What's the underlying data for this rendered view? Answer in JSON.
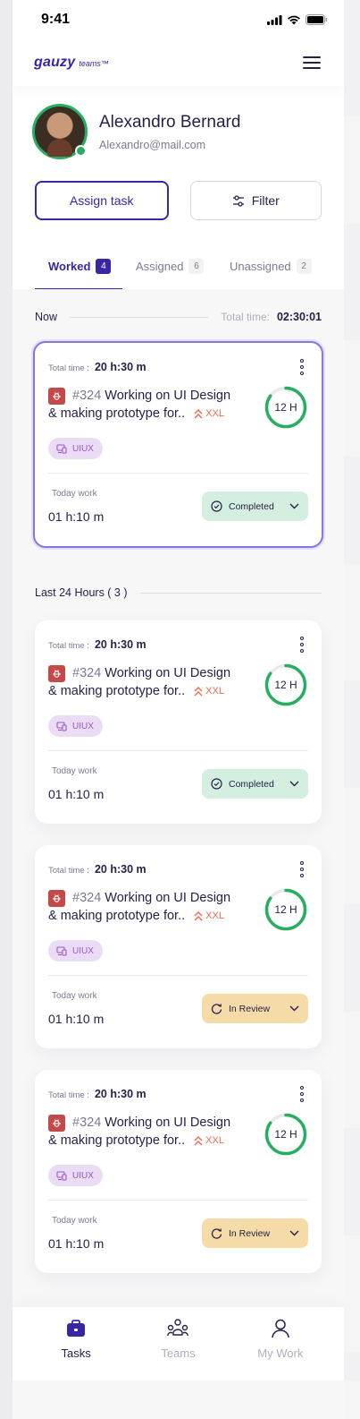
{
  "status_bar": {
    "time": "9:41"
  },
  "header": {
    "logo_main": "gauzy",
    "logo_sub": "teams™"
  },
  "profile": {
    "name": "Alexandro Bernard",
    "email": "Alexandro@mail.com"
  },
  "actions": {
    "assign_label": "Assign task",
    "filter_label": "Filter"
  },
  "tabs": [
    {
      "label": "Worked",
      "count": "4",
      "active": true
    },
    {
      "label": "Assigned",
      "count": "6",
      "active": false
    },
    {
      "label": "Unassigned",
      "count": "2",
      "active": false
    }
  ],
  "now_section": {
    "label": "Now",
    "total_label": "Total time:",
    "total_value": "02:30:01"
  },
  "last24_section": {
    "label": "Last 24 Hours ( 3 )"
  },
  "tasks": [
    {
      "total_label": "Total time :",
      "total_value": "20 h:30 m",
      "task_number": "#324",
      "title_line1": "Working on UI Design",
      "title_line2": "& making prototype for..",
      "size": "XXL",
      "estimate": "12 H",
      "progress_fraction": 0.85,
      "tag": "UIUX",
      "today_label": "Today work",
      "today_value": "01 h:10 m",
      "status": "Completed",
      "status_type": "completed",
      "selected": true
    },
    {
      "total_label": "Total time :",
      "total_value": "20 h:30 m",
      "task_number": "#324",
      "title_line1": "Working on UI Design",
      "title_line2": "& making prototype for..",
      "size": "XXL",
      "estimate": "12 H",
      "progress_fraction": 0.85,
      "tag": "UIUX",
      "today_label": "Today work",
      "today_value": "01 h:10 m",
      "status": "Completed",
      "status_type": "completed",
      "selected": false
    },
    {
      "total_label": "Total time :",
      "total_value": "20 h:30 m",
      "task_number": "#324",
      "title_line1": "Working on UI Design",
      "title_line2": "& making prototype for..",
      "size": "XXL",
      "estimate": "12 H",
      "progress_fraction": 0.85,
      "tag": "UIUX",
      "today_label": "Today work",
      "today_value": "01 h:10 m",
      "status": "In Review",
      "status_type": "review",
      "selected": false
    },
    {
      "total_label": "Total time :",
      "total_value": "20 h:30 m",
      "task_number": "#324",
      "title_line1": "Working on UI Design",
      "title_line2": "& making prototype for..",
      "size": "XXL",
      "estimate": "12 H",
      "progress_fraction": 0.85,
      "tag": "UIUX",
      "today_label": "Today work",
      "today_value": "01 h:10 m",
      "status": "In Review",
      "status_type": "review",
      "selected": false
    }
  ],
  "bottom_nav": [
    {
      "label": "Tasks",
      "icon": "briefcase-icon",
      "active": true
    },
    {
      "label": "Teams",
      "icon": "people-icon",
      "active": false
    },
    {
      "label": "My Work",
      "icon": "user-icon",
      "active": false
    }
  ],
  "colors": {
    "primary": "#3826a6",
    "completed": "#d4efdf",
    "review": "#f5dba7",
    "ring": "#27ae60",
    "size": "#ef6a4b",
    "bug": "#c24a4a"
  }
}
